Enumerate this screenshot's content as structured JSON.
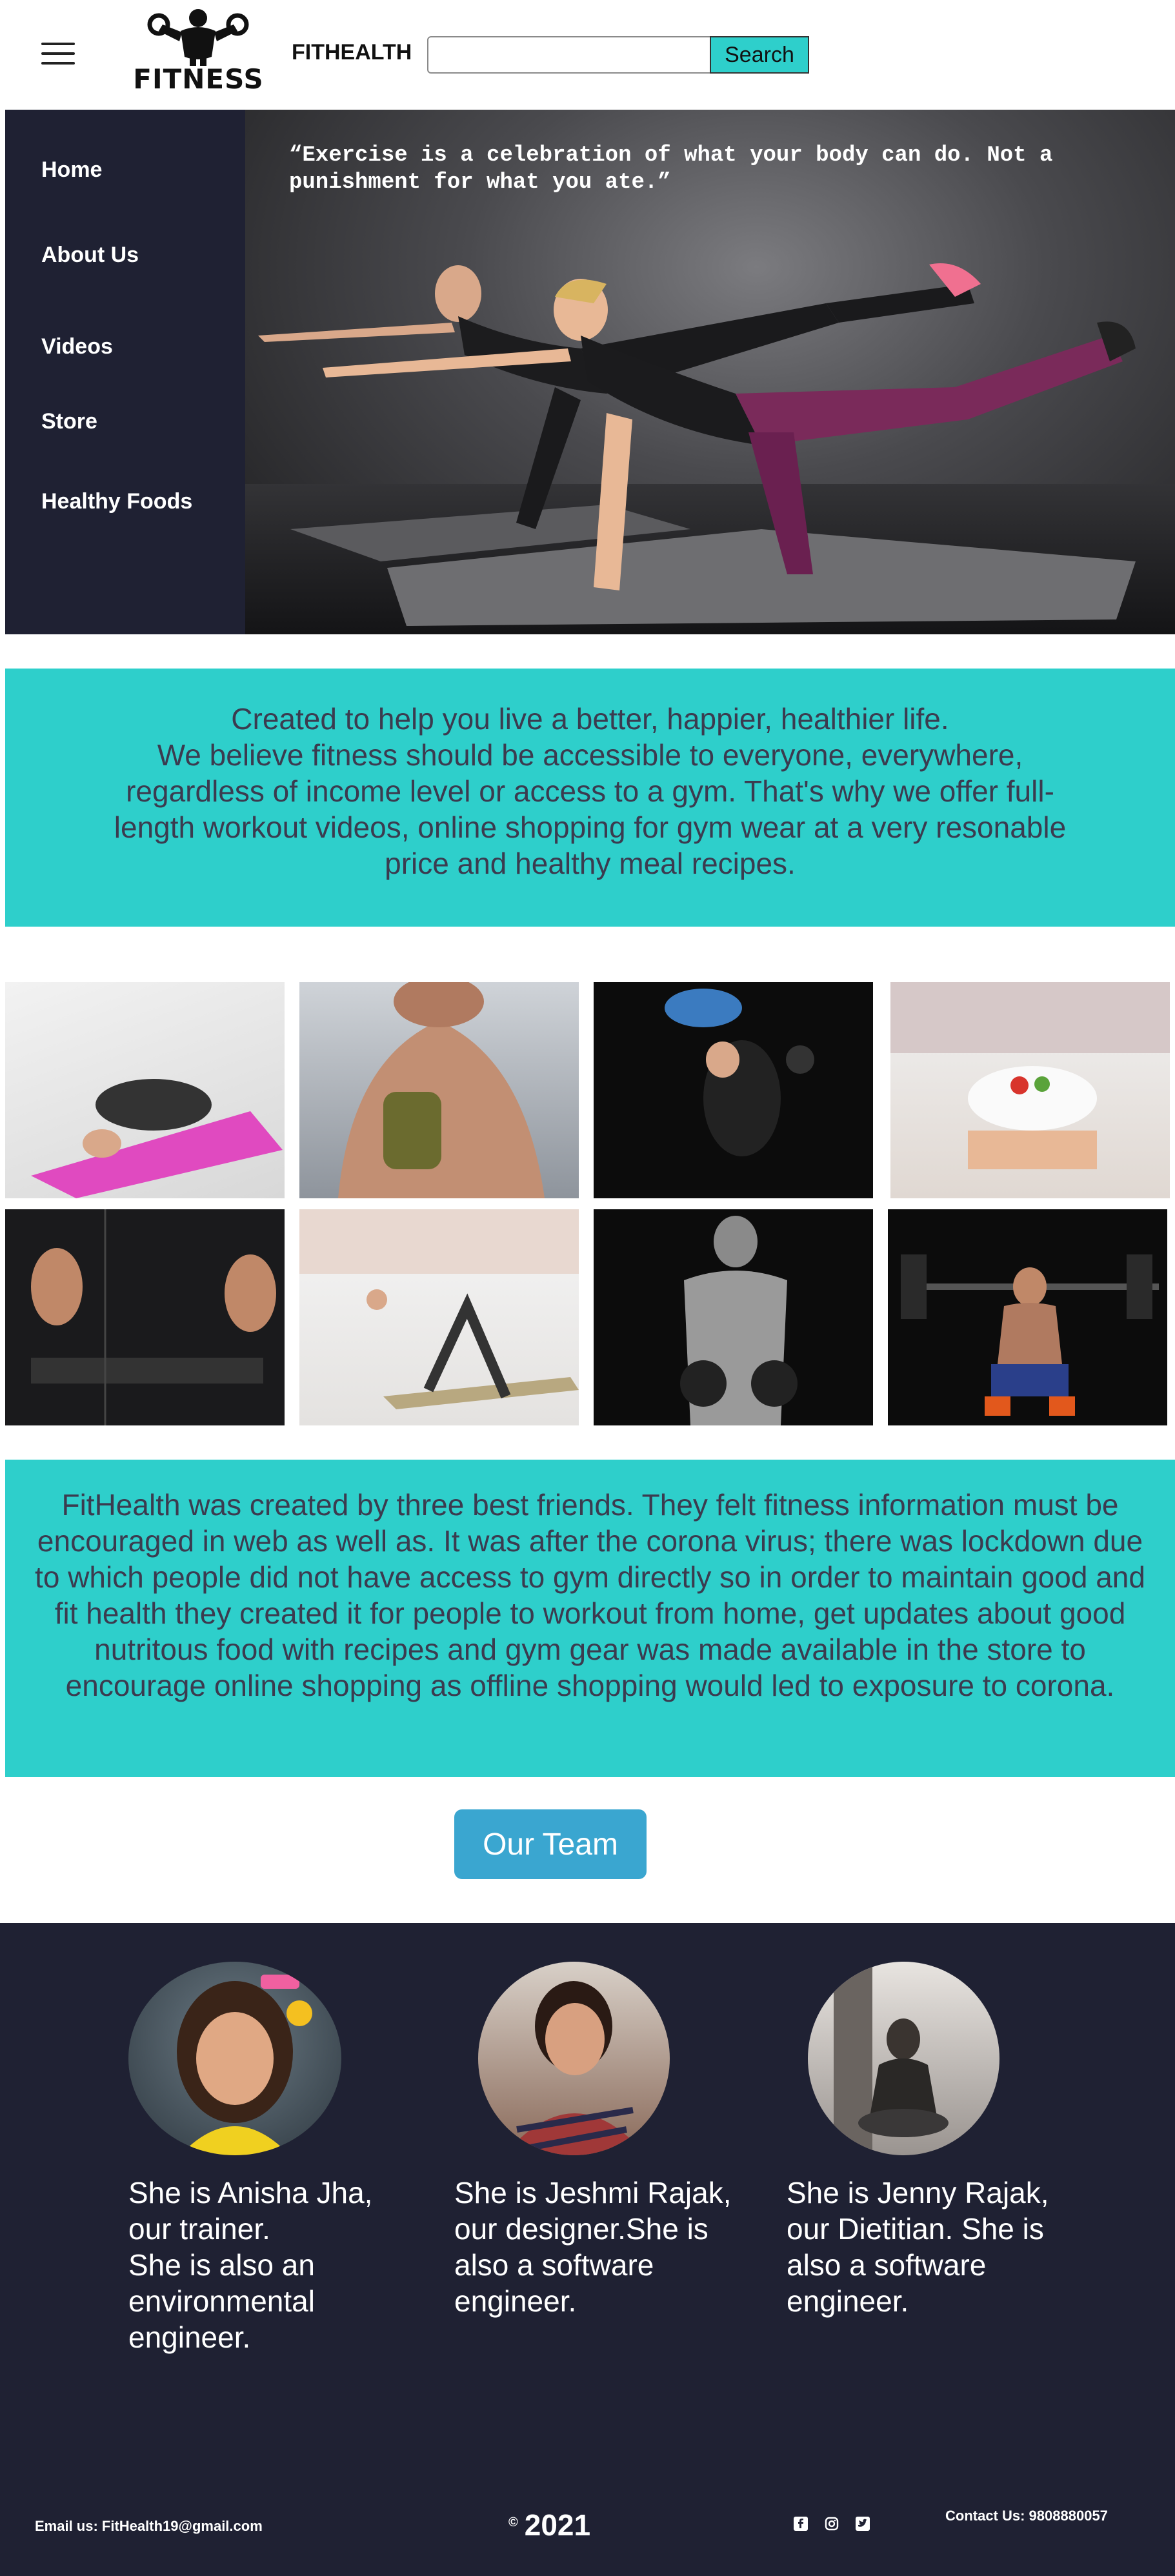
{
  "header": {
    "menu_icon": "hamburger-menu-icon",
    "logo_text": "FITNESS",
    "brand": "FITHEALTH",
    "search": {
      "placeholder": "",
      "value": "",
      "button_label": "Search"
    }
  },
  "sidebar": {
    "items": [
      {
        "label": "Home"
      },
      {
        "label": "About Us"
      },
      {
        "label": "Videos"
      },
      {
        "label": "Store"
      },
      {
        "label": "Healthy Foods"
      }
    ]
  },
  "hero": {
    "quote": "“Exercise is a celebration of what your body can do. Not a punishment for what you ate.”"
  },
  "intro": {
    "lines": [
      "Created to help you live a better, happier, healthier life.",
      "We believe fitness should be accessible to everyone, everywhere, regardless of income level or access to a gym. That's why we offer full-length workout videos, online shopping for gym wear at a very resonable price and healthy meal recipes."
    ]
  },
  "about": {
    "text": "FitHealth was created by three best friends. They felt fitness information must be encouraged in web as well as. It was after the corona virus; there was lockdown due to which people did not have access to gym directly so in order to maintain good and fit health  they created it for people to workout from home, get updates about good nutritous food with recipes and gym gear was made available in the store to encourage online shopping as offline shopping would led to exposure to corona."
  },
  "team": {
    "button_label": "Our Team",
    "members": [
      {
        "text": "She is Anisha Jha, our trainer.\nShe is also an environmental engineer."
      },
      {
        "text": "She is Jeshmi Rajak, our designer.She is also a software engineer."
      },
      {
        "text": "She is Jenny Rajak, our Dietitian. She is also a software engineer."
      }
    ]
  },
  "footer": {
    "email": "Email us: FitHealth19@gmail.com",
    "copyright_symbol": "©",
    "year": "2021",
    "social_icons": [
      "facebook-icon",
      "instagram-icon",
      "twitter-icon"
    ],
    "contact": "Contact Us: 9808880057"
  },
  "colors": {
    "teal": "#2ecfcb",
    "navy": "#1f2133",
    "team_button": "#3aa6d0"
  }
}
